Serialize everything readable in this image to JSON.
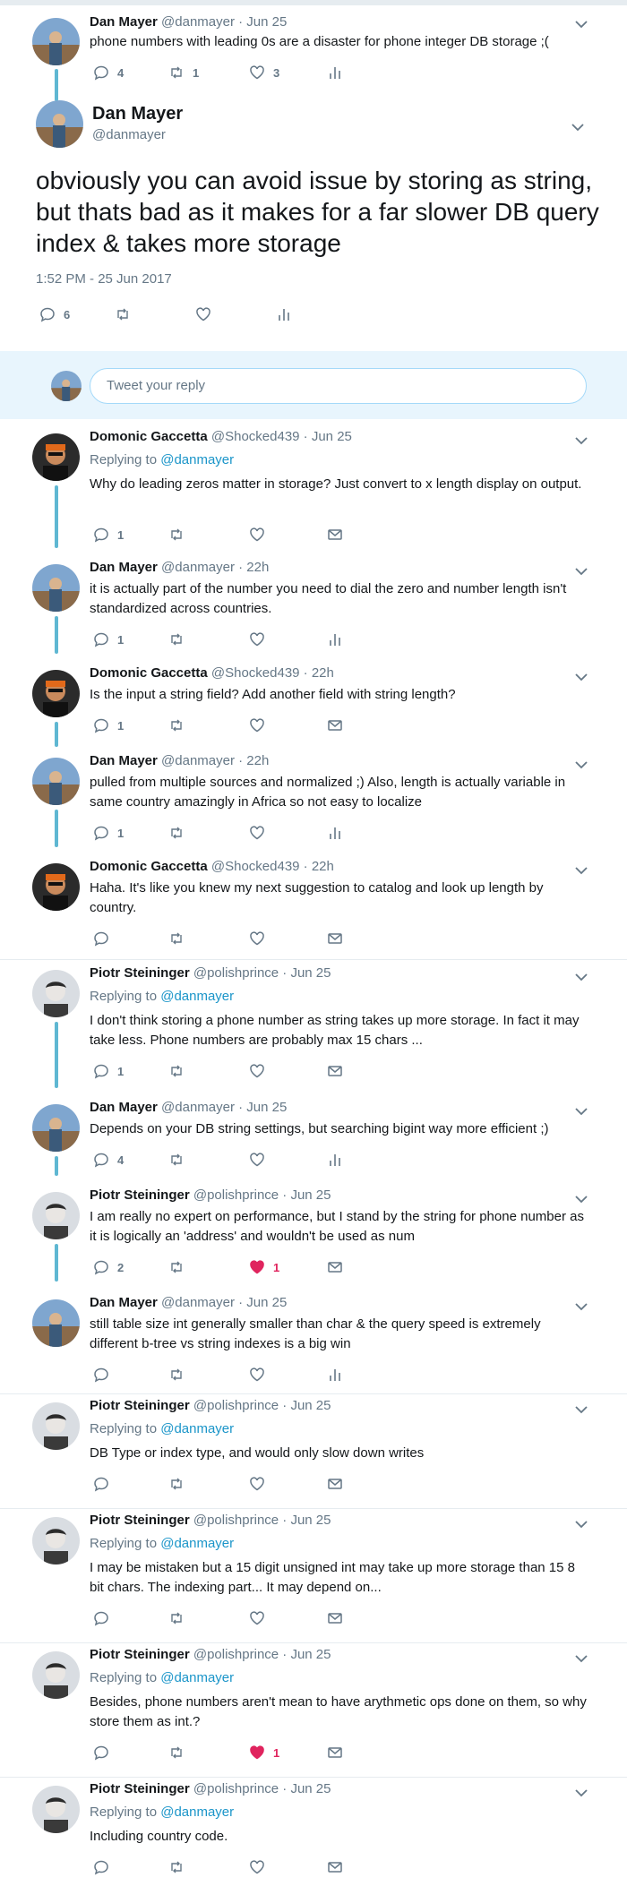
{
  "top_tweet": {
    "name": "Dan Mayer",
    "meta": "@danmayer · Jun 25",
    "text": "phone numbers with leading 0s are a disaster for phone integer DB storage ;(",
    "replies": "4",
    "retweets": "1",
    "likes": "3"
  },
  "main_tweet": {
    "name": "Dan Mayer",
    "handle": "@danmayer",
    "text": "obviously you can avoid issue by storing as string, but thats bad as it makes for a far slower DB query index & takes more storage",
    "timestamp": "1:52 PM - 25 Jun 2017",
    "replies": "6"
  },
  "reply_box": {
    "placeholder": "Tweet your reply"
  },
  "replying_label": "Replying to",
  "replying_handle": "@danmayer",
  "replies": [
    {
      "name": "Domonic Gaccetta",
      "meta": "@Shocked439 · Jun 25",
      "replying": true,
      "text": "Why do leading zeros matter in storage? Just convert to x length display on output.",
      "reply_count": "1",
      "like_count": "",
      "liked": false,
      "fourth": "mail"
    },
    {
      "name": "Dan Mayer",
      "meta": "@danmayer · 22h",
      "replying": false,
      "text": "it is actually part of the number you need to dial the zero and number length isn't standardized across countries.",
      "reply_count": "1",
      "like_count": "",
      "liked": false,
      "fourth": "stats"
    },
    {
      "name": "Domonic Gaccetta",
      "meta": "@Shocked439 · 22h",
      "replying": false,
      "text": "Is the input a string field? Add another field with string length?",
      "reply_count": "1",
      "like_count": "",
      "liked": false,
      "fourth": "mail"
    },
    {
      "name": "Dan Mayer",
      "meta": "@danmayer · 22h",
      "replying": false,
      "text": "pulled from multiple sources and normalized ;) Also, length is actually variable in same country amazingly in Africa so not easy to localize",
      "reply_count": "1",
      "like_count": "",
      "liked": false,
      "fourth": "stats"
    },
    {
      "name": "Domonic Gaccetta",
      "meta": "@Shocked439 · 22h",
      "replying": false,
      "text": "Haha. It's like you knew my next suggestion to catalog and look up length by country.",
      "reply_count": "",
      "like_count": "",
      "liked": false,
      "fourth": "mail"
    },
    {
      "name": "Piotr Steininger",
      "meta": "@polishprince · Jun 25",
      "replying": true,
      "text": "I don't think storing a phone number as string takes up more storage. In fact it may take less. Phone numbers are probably max 15 chars ...",
      "reply_count": "1",
      "like_count": "",
      "liked": false,
      "fourth": "mail"
    },
    {
      "name": "Dan Mayer",
      "meta": "@danmayer · Jun 25",
      "replying": false,
      "text": "Depends on your DB string settings, but searching bigint way more efficient ;)",
      "reply_count": "4",
      "like_count": "",
      "liked": false,
      "fourth": "stats"
    },
    {
      "name": "Piotr Steininger",
      "meta": "@polishprince · Jun 25",
      "replying": false,
      "text": "I am really no expert on performance, but I stand by the string for phone number as it is logically an 'address' and wouldn't be used as num",
      "reply_count": "2",
      "like_count": "1",
      "liked": true,
      "fourth": "mail"
    },
    {
      "name": "Dan Mayer",
      "meta": "@danmayer · Jun 25",
      "replying": false,
      "text": "still table size int generally smaller than char & the query speed is extremely different b-tree vs string indexes is a big win",
      "reply_count": "",
      "like_count": "",
      "liked": false,
      "fourth": "stats"
    },
    {
      "name": "Piotr Steininger",
      "meta": "@polishprince · Jun 25",
      "replying": true,
      "text": "DB Type or index type, and would only slow down writes",
      "reply_count": "",
      "like_count": "",
      "liked": false,
      "fourth": "mail"
    },
    {
      "name": "Piotr Steininger",
      "meta": "@polishprince · Jun 25",
      "replying": true,
      "text": "I may be mistaken but a 15 digit unsigned int may take up more storage than 15 8 bit chars. The indexing part... It may depend on...",
      "reply_count": "",
      "like_count": "",
      "liked": false,
      "fourth": "mail"
    },
    {
      "name": "Piotr Steininger",
      "meta": "@polishprince · Jun 25",
      "replying": true,
      "text": "Besides, phone numbers aren't mean to have arythmetic ops done on them, so why store them as int.?",
      "reply_count": "",
      "like_count": "1",
      "liked": true,
      "fourth": "mail"
    },
    {
      "name": "Piotr Steininger",
      "meta": "@polishprince · Jun 25",
      "replying": true,
      "text": "Including country code.",
      "reply_count": "",
      "like_count": "",
      "liked": false,
      "fourth": "mail"
    }
  ],
  "colors": {
    "thread_line": "#5fb7d2",
    "link": "#1b95c9",
    "like_active": "#e0245e",
    "muted": "#657786",
    "reply_box_bg": "#e8f5fd"
  }
}
